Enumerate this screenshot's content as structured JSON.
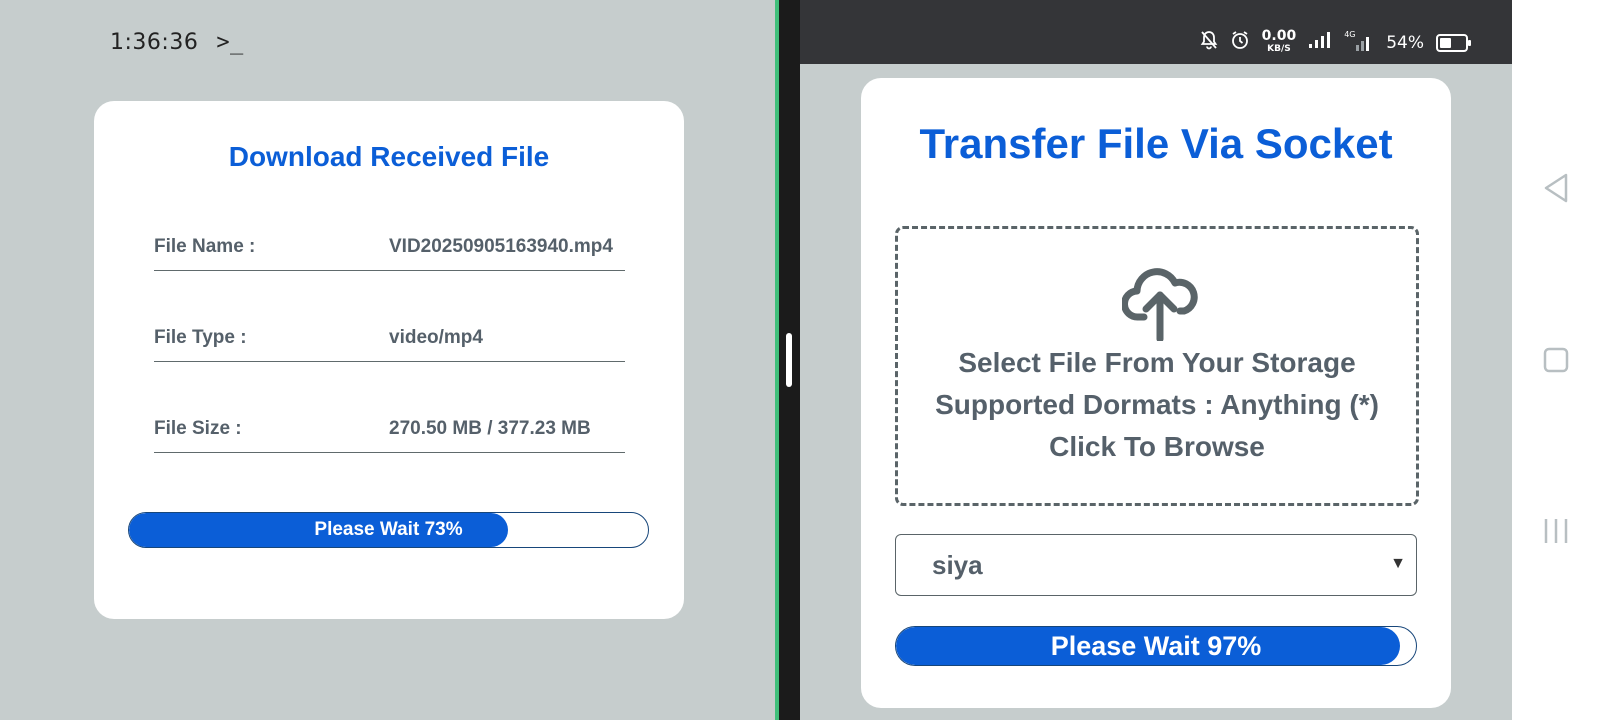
{
  "left": {
    "clock": "1:36:36",
    "terminal_icon": "terminal-prompt-icon",
    "card_title": "Download Received File",
    "rows": [
      {
        "label": "File Name :",
        "value": "VID20250905163940.mp4"
      },
      {
        "label": "File Type :",
        "value": "video/mp4"
      },
      {
        "label": "File Size :",
        "value": "270.50 MB / 377.23 MB"
      }
    ],
    "progress": {
      "text": "Please Wait 73%",
      "fraction": 0.73
    }
  },
  "right": {
    "status": {
      "speed_value": "0.00",
      "speed_unit": "KB/S",
      "network": "4G",
      "battery": "54%",
      "battery_fraction": 0.54,
      "icons": [
        "bell-off-icon",
        "alarm-icon",
        "signal-icon",
        "signal-4g-icon",
        "battery-icon"
      ]
    },
    "card_title": "Transfer File Via Socket",
    "dropzone": {
      "line1": "Select File From Your Storage",
      "line2": "Supported Dormats : Anything (*)",
      "line3": "Click To Browse",
      "icon": "cloud-upload-icon"
    },
    "select": {
      "value": "siya"
    },
    "progress": {
      "text": "Please Wait 97%",
      "fraction": 0.97
    }
  },
  "nav": {
    "icons": [
      "back-triangle-icon",
      "home-square-icon",
      "recents-icon"
    ]
  },
  "colors": {
    "accent": "#0b5ed7",
    "text_gray": "#55606a",
    "background": "#c6cdcd",
    "status_bar": "#343538",
    "split_green": "#3fbf7a"
  }
}
